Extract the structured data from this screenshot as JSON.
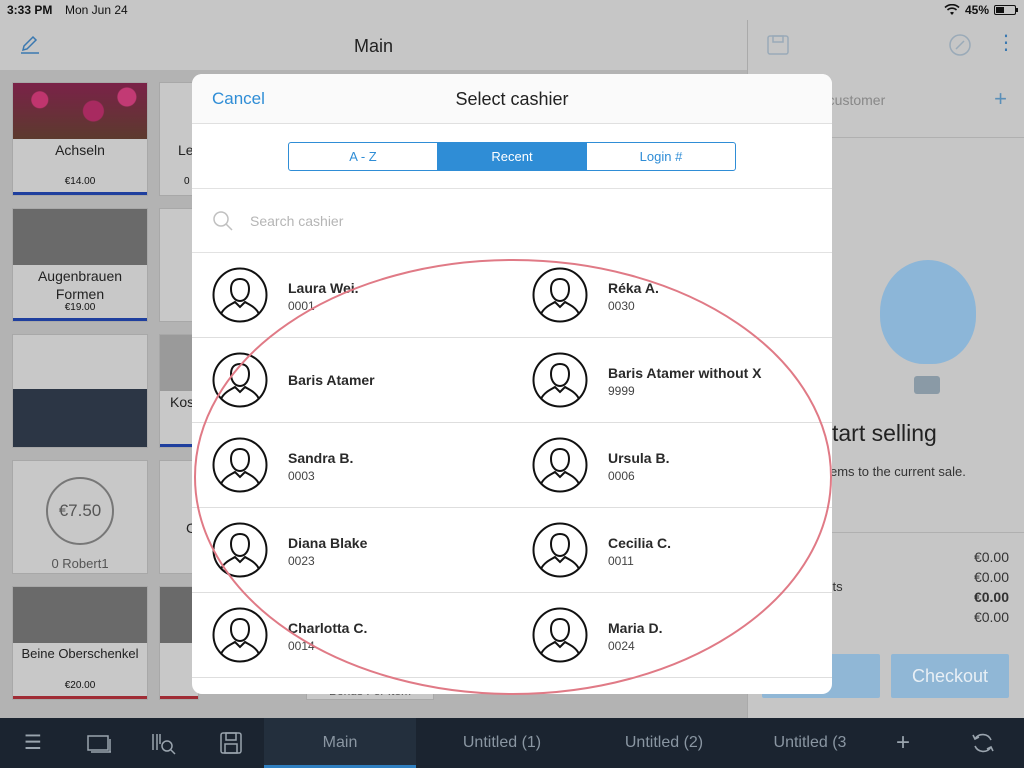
{
  "status_bar": {
    "time": "3:33 PM",
    "date": "Mon Jun 24",
    "battery": "45%"
  },
  "background": {
    "header_title": "Main",
    "tiles": [
      {
        "name": "Achseln",
        "price": "€14.00"
      },
      {
        "name": "Le",
        "price": "0"
      },
      {
        "name": "Augenbrauen Formen",
        "price": "€19.00"
      },
      {
        "name": "Kos",
        "price": ""
      },
      {
        "name": "0 Robert1",
        "price": "€7.50"
      },
      {
        "name": "C",
        "price": ""
      },
      {
        "name": "Beine Oberschenkel",
        "price": "€20.00"
      }
    ],
    "customer_placeholder": "d customer",
    "start_title": "tart selling",
    "start_sub": "ems to the current sale.",
    "totals": [
      {
        "label": "",
        "value": "€0.00",
        "bold": false
      },
      {
        "label": "unts",
        "value": "€0.00",
        "bold": false
      },
      {
        "label": "",
        "value": "€0.00",
        "bold": true
      },
      {
        "label": "",
        "value": "€0.00",
        "bold": false
      }
    ],
    "partial_button": "o",
    "checkout_button": "Checkout",
    "bonus_labels": [
      "Bonus Fer Item",
      "Bonus"
    ]
  },
  "bottom_bar": {
    "tabs": [
      "Main",
      "Untitled (1)",
      "Untitled (2)",
      "Untitled (3"
    ],
    "active_tab": "Main"
  },
  "modal": {
    "cancel_label": "Cancel",
    "title": "Select cashier",
    "segments": [
      "A - Z",
      "Recent",
      "Login #"
    ],
    "active_segment": "Recent",
    "search_placeholder": "Search cashier",
    "cashiers": [
      {
        "name": "Laura Wei.",
        "code": "0001"
      },
      {
        "name": "Réka A.",
        "code": "0030"
      },
      {
        "name": "Baris Atamer",
        "code": ""
      },
      {
        "name": "Baris Atamer without X",
        "code": "9999"
      },
      {
        "name": "Sandra B.",
        "code": "0003"
      },
      {
        "name": "Ursula B.",
        "code": "0006"
      },
      {
        "name": "Diana Blake",
        "code": "0023"
      },
      {
        "name": "Cecilia C.",
        "code": "0011"
      },
      {
        "name": "Charlotta C.",
        "code": "0014"
      },
      {
        "name": "Maria D.",
        "code": "0024"
      }
    ]
  },
  "colors": {
    "accent": "#2f8dd6",
    "annotation": "#e07a86",
    "bottom_bar": "#1b2430"
  }
}
